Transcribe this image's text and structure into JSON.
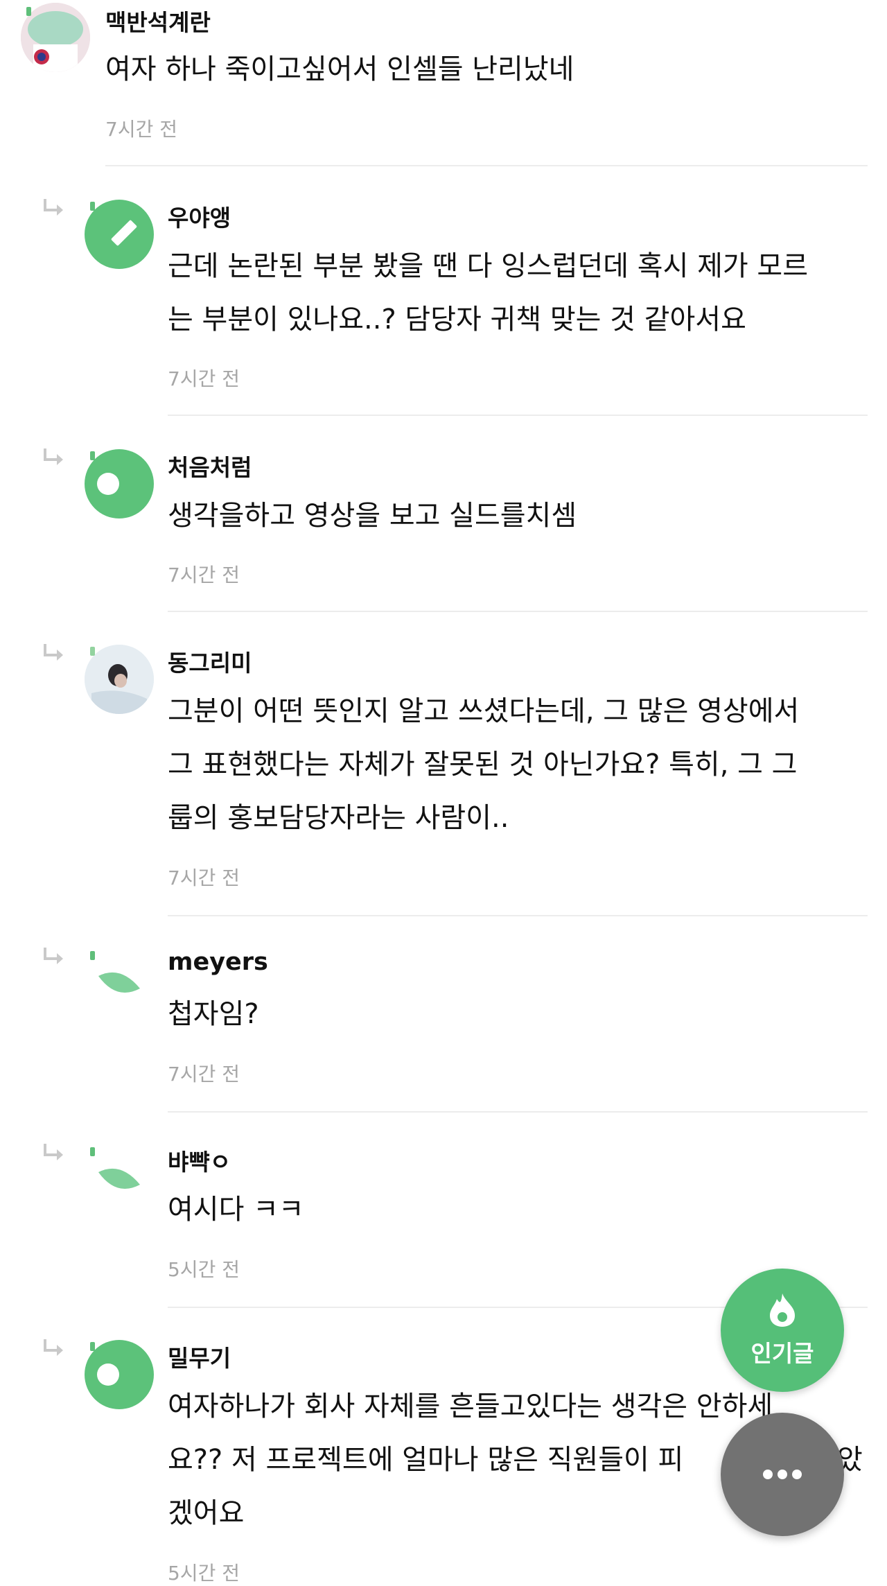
{
  "comments": [
    {
      "author": "맥반석계란",
      "text_lines": [
        "여자 하나 죽이고싶어서 인셀들 난리났네"
      ],
      "time": "7시간 전"
    },
    {
      "author": "우야앵",
      "text_lines": [
        "근데 논란된 부분 봤을 땐 다 잉스럽던데 혹시 제가 모르",
        "는 부분이 있나요..? 담당자 귀책 맞는 것 같아서요"
      ],
      "time": "7시간 전"
    },
    {
      "author": "처음처럼",
      "text_lines": [
        "생각을하고 영상을 보고 실드를치셈"
      ],
      "time": "7시간 전"
    },
    {
      "author": "동그리미",
      "text_lines": [
        "그분이 어떤 뜻인지 알고 쓰셨다는데, 그 많은 영상에서",
        "그 표현했다는 자체가 잘못된 것 아닌가요? 특히, 그 그",
        "룹의 홍보담당자라는 사람이.."
      ],
      "time": "7시간 전"
    },
    {
      "author": "meyers",
      "text_lines": [
        "첩자임?"
      ],
      "time": "7시간 전"
    },
    {
      "author": "뱌뺙ㅇ",
      "text_lines": [
        "여시다 ㅋㅋ"
      ],
      "time": "5시간 전"
    },
    {
      "author": "밀무기",
      "text_lines": [
        "여자하나가 회사 자체를 흔들고있다는 생각은 안하세",
        "요?? 저 프로젝트에 얼마나 많은 직원들이 피",
        "겠어요"
      ],
      "text_tail": "았",
      "time": "5시간 전"
    }
  ],
  "fab": {
    "hot_label": "인기글",
    "hot_icon": "fire-icon",
    "more_icon": "more-dots-icon",
    "hot_color": "#55bf78",
    "more_color": "#727272"
  },
  "colors": {
    "avatar_green": "#5cc27a",
    "leaf_green": "#7fd09a",
    "time_gray": "#a6a6a6"
  }
}
